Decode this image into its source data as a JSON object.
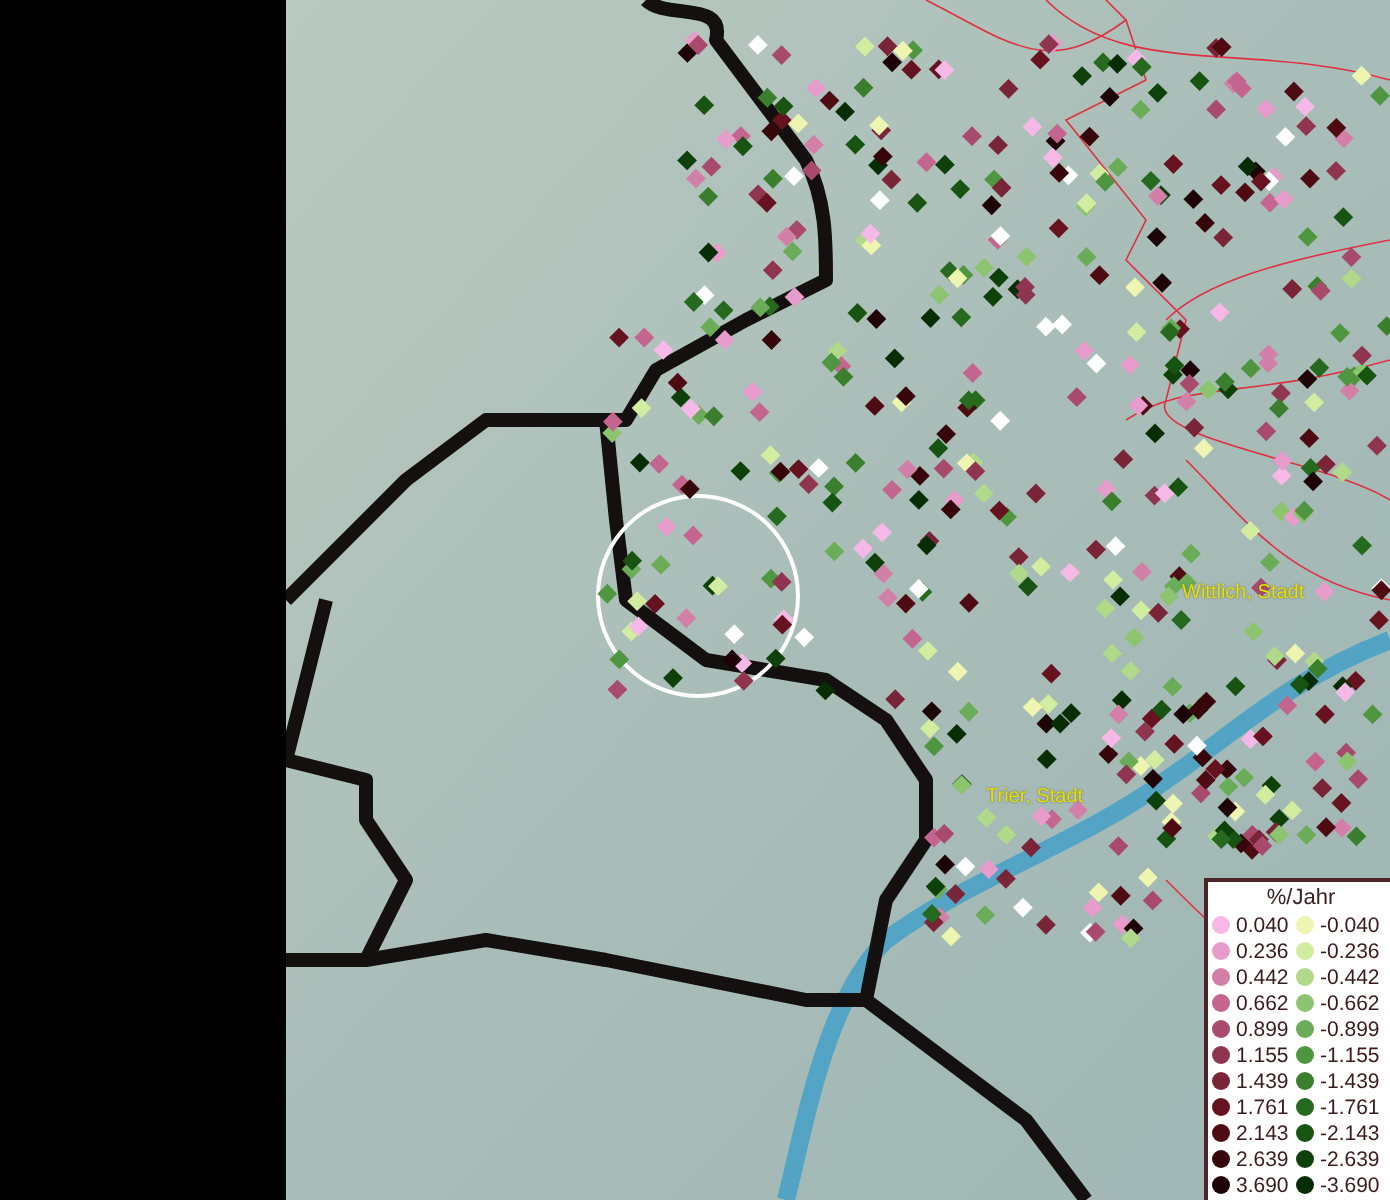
{
  "map": {
    "labels": [
      {
        "text": "Wittlich, Stadt"
      },
      {
        "text": "Trier, Stadt"
      }
    ]
  },
  "legend": {
    "title": "%/Jahr",
    "positive": [
      {
        "value": "0.040",
        "color": "#f6b8e6"
      },
      {
        "value": "0.236",
        "color": "#e79ccb"
      },
      {
        "value": "0.442",
        "color": "#d380a9"
      },
      {
        "value": "0.662",
        "color": "#c46590"
      },
      {
        "value": "0.899",
        "color": "#a84a6c"
      },
      {
        "value": "1.155",
        "color": "#8f3550"
      },
      {
        "value": "1.439",
        "color": "#7a2438"
      },
      {
        "value": "1.761",
        "color": "#66131f"
      },
      {
        "value": "2.143",
        "color": "#4e0c12"
      },
      {
        "value": "2.639",
        "color": "#36060a"
      },
      {
        "value": "3.690",
        "color": "#1e0306"
      }
    ],
    "negative": [
      {
        "value": "-0.040",
        "color": "#eef5b0"
      },
      {
        "value": "-0.236",
        "color": "#d2eca0"
      },
      {
        "value": "-0.442",
        "color": "#b0d98a"
      },
      {
        "value": "-0.662",
        "color": "#8cc470"
      },
      {
        "value": "-0.899",
        "color": "#6aac58"
      },
      {
        "value": "-1.155",
        "color": "#4f9640"
      },
      {
        "value": "-1.439",
        "color": "#3a7f2e"
      },
      {
        "value": "-1.761",
        "color": "#256a1e"
      },
      {
        "value": "-2.143",
        "color": "#175412"
      },
      {
        "value": "-2.639",
        "color": "#0e400a"
      },
      {
        "value": "-3.690",
        "color": "#072d05"
      }
    ]
  }
}
